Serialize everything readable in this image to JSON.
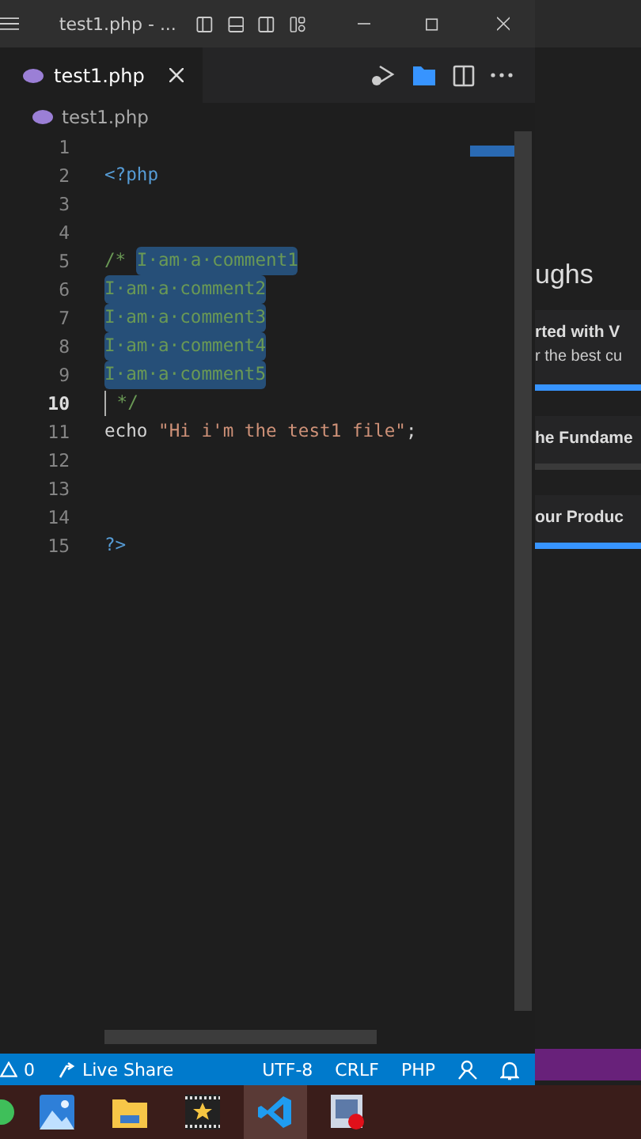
{
  "window": {
    "title": "test1.php - ..."
  },
  "tabs": [
    {
      "label": "test1.php",
      "selected": true
    }
  ],
  "breadcrumb": [
    "test1.php"
  ],
  "editor": {
    "lines": [
      {
        "number": "1",
        "active": false
      },
      {
        "number": "2",
        "active": false,
        "tokens": [
          {
            "text": "<?php",
            "kind": "tag",
            "selected": false
          }
        ]
      },
      {
        "number": "3",
        "active": false
      },
      {
        "number": "4",
        "active": false
      },
      {
        "number": "5",
        "active": false,
        "tokens": [
          {
            "text": "/* ",
            "kind": "comment",
            "selected": false
          },
          {
            "text": "I·am·a·comment1",
            "kind": "comment",
            "selected": true
          }
        ]
      },
      {
        "number": "6",
        "active": false,
        "tokens": [
          {
            "text": "I·am·a·comment2",
            "kind": "comment",
            "selected": true
          }
        ]
      },
      {
        "number": "7",
        "active": false,
        "tokens": [
          {
            "text": "I·am·a·comment3",
            "kind": "comment",
            "selected": true
          }
        ]
      },
      {
        "number": "8",
        "active": false,
        "tokens": [
          {
            "text": "I·am·a·comment4",
            "kind": "comment",
            "selected": true
          }
        ]
      },
      {
        "number": "9",
        "active": false,
        "tokens": [
          {
            "text": "I·am·a·comment5",
            "kind": "comment",
            "selected": true
          }
        ]
      },
      {
        "number": "10",
        "active": true,
        "tokens": [
          {
            "text": " */",
            "kind": "comment",
            "selected": false
          }
        ]
      },
      {
        "number": "11",
        "active": false,
        "tokens": [
          {
            "text": "echo ",
            "kind": "plain",
            "selected": false
          },
          {
            "text": "\"Hi i'm the test1 file\"",
            "kind": "string",
            "selected": false
          },
          {
            "text": ";",
            "kind": "plain",
            "selected": false
          }
        ]
      },
      {
        "number": "12",
        "active": false
      },
      {
        "number": "13",
        "active": false
      },
      {
        "number": "14",
        "active": false
      },
      {
        "number": "15",
        "active": false,
        "tokens": [
          {
            "text": "?>",
            "kind": "tag",
            "selected": false
          }
        ]
      }
    ]
  },
  "background_window": {
    "heading": "ughs",
    "items": [
      {
        "title": "rted with V",
        "description": "r the best cu",
        "level": 1
      },
      {
        "title": "he Fundame",
        "level": 0
      },
      {
        "title": "our Produc",
        "level": 1
      }
    ]
  },
  "status_bar": [
    {
      "kind": "problems",
      "text": "0"
    },
    {
      "kind": "liveshare",
      "text": "Live Share"
    },
    {
      "kind": "text",
      "text": "UTF-8"
    },
    {
      "kind": "text",
      "text": "CRLF"
    },
    {
      "kind": "text",
      "text": "PHP"
    },
    {
      "kind": "feedback"
    },
    {
      "kind": "bell"
    }
  ],
  "taskbar": [
    {
      "kind": "dot",
      "selected": false
    },
    {
      "kind": "photos",
      "selected": false
    },
    {
      "kind": "folder",
      "selected": false
    },
    {
      "kind": "movie",
      "selected": false
    },
    {
      "kind": "vscode",
      "selected": true
    },
    {
      "kind": "recorder",
      "selected": false
    }
  ]
}
